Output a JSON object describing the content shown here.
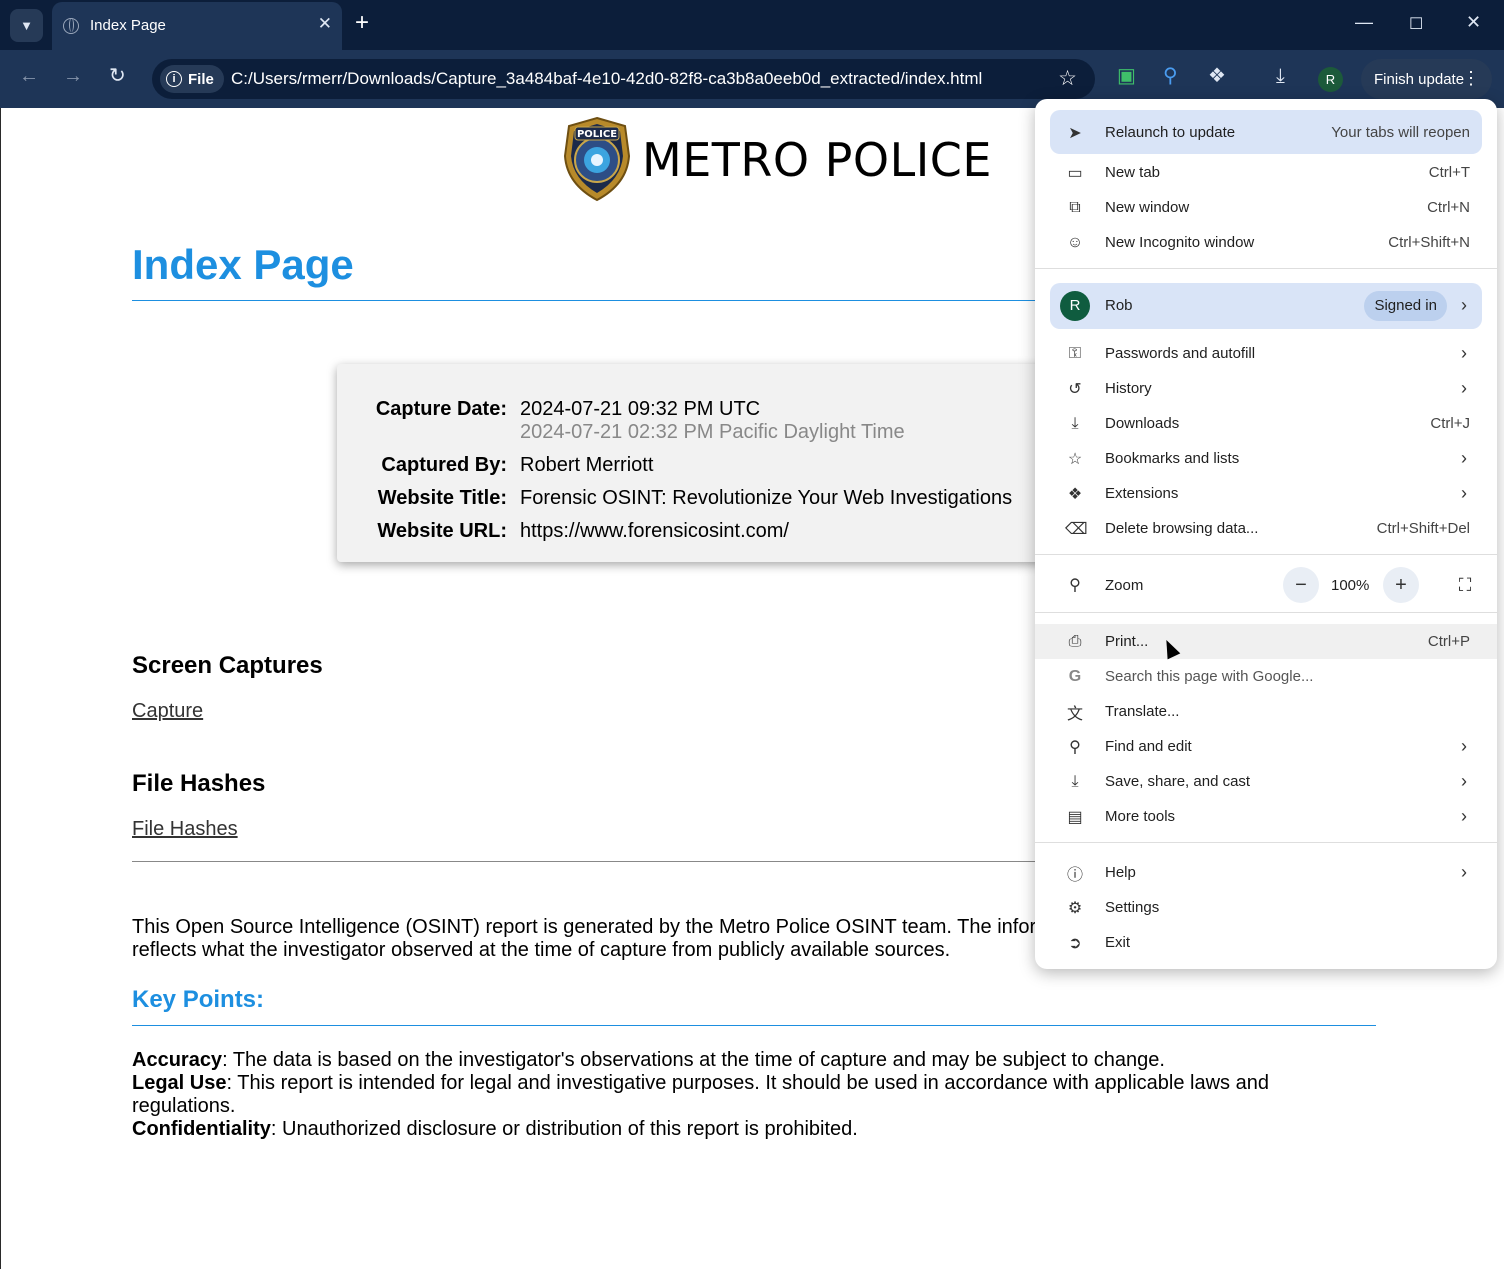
{
  "browser": {
    "tab_title": "Index Page",
    "chip_label": "File",
    "url": "C:/Users/rmerr/Downloads/Capture_3a484baf-4e10-42d0-82f8-ca3b8a0eeb0d_extracted/index.html",
    "profile_initial": "R",
    "finish_update_label": "Finish update"
  },
  "page": {
    "site_name": "METRO POLICE",
    "badge_text": "POLICE",
    "title": "Index Page",
    "capture_info": [
      {
        "label": "Capture Date:",
        "value": "2024-07-21 09:32 PM UTC",
        "sub": "2024-07-21 02:32 PM Pacific Daylight Time"
      },
      {
        "label": "Captured By:",
        "value": "Robert Merriott"
      },
      {
        "label": "Website Title:",
        "value": "Forensic OSINT: Revolutionize Your Web Investigations"
      },
      {
        "label": "Website URL:",
        "value": "https://www.forensicosint.com/"
      }
    ],
    "screen_captures_heading": "Screen Captures",
    "capture_link": "Capture",
    "file_hashes_heading": "File Hashes",
    "file_hashes_link": "File Hashes",
    "intro_paragraph_line1": "This Open Source Intelligence (OSINT) report is generated by the Metro Police OSINT team. The infor",
    "intro_paragraph_line2": "reflects what the investigator observed at the time of capture from publicly available sources.",
    "key_points_heading": "Key Points:",
    "key_points": [
      {
        "term": "Accuracy",
        "text": ": The data is based on the investigator's observations at the time of capture and may be subject to change."
      },
      {
        "term": "Legal Use",
        "text": ": This report is intended for legal and investigative purposes. It should be used in accordance with applicable laws and regulations."
      },
      {
        "term": "Confidentiality",
        "text": ": Unauthorized disclosure or distribution of this report is prohibited."
      }
    ]
  },
  "menu": {
    "relaunch": {
      "label": "Relaunch to update",
      "hint": "Your tabs will reopen"
    },
    "new_tab": {
      "label": "New tab",
      "shortcut": "Ctrl+T"
    },
    "new_window": {
      "label": "New window",
      "shortcut": "Ctrl+N"
    },
    "incognito": {
      "label": "New Incognito window",
      "shortcut": "Ctrl+Shift+N"
    },
    "profile": {
      "initial": "R",
      "name": "Rob",
      "status": "Signed in"
    },
    "passwords": {
      "label": "Passwords and autofill"
    },
    "history": {
      "label": "History"
    },
    "downloads": {
      "label": "Downloads",
      "shortcut": "Ctrl+J"
    },
    "bookmarks": {
      "label": "Bookmarks and lists"
    },
    "extensions": {
      "label": "Extensions"
    },
    "delete_data": {
      "label": "Delete browsing data...",
      "shortcut": "Ctrl+Shift+Del"
    },
    "zoom": {
      "label": "Zoom",
      "value": "100%",
      "minus": "−",
      "plus": "+"
    },
    "print": {
      "label": "Print...",
      "shortcut": "Ctrl+P"
    },
    "search_google": {
      "label": "Search this page with Google..."
    },
    "translate": {
      "label": "Translate..."
    },
    "find_edit": {
      "label": "Find and edit"
    },
    "save_share": {
      "label": "Save, share, and cast"
    },
    "more_tools": {
      "label": "More tools"
    },
    "help": {
      "label": "Help"
    },
    "settings": {
      "label": "Settings"
    },
    "exit": {
      "label": "Exit"
    }
  },
  "colors": {
    "accent_blue": "#1d8fe0",
    "chrome_dark": "#0c1e3a",
    "chrome_toolbar": "#1e3557",
    "menu_highlight": "#d9e4f7"
  }
}
